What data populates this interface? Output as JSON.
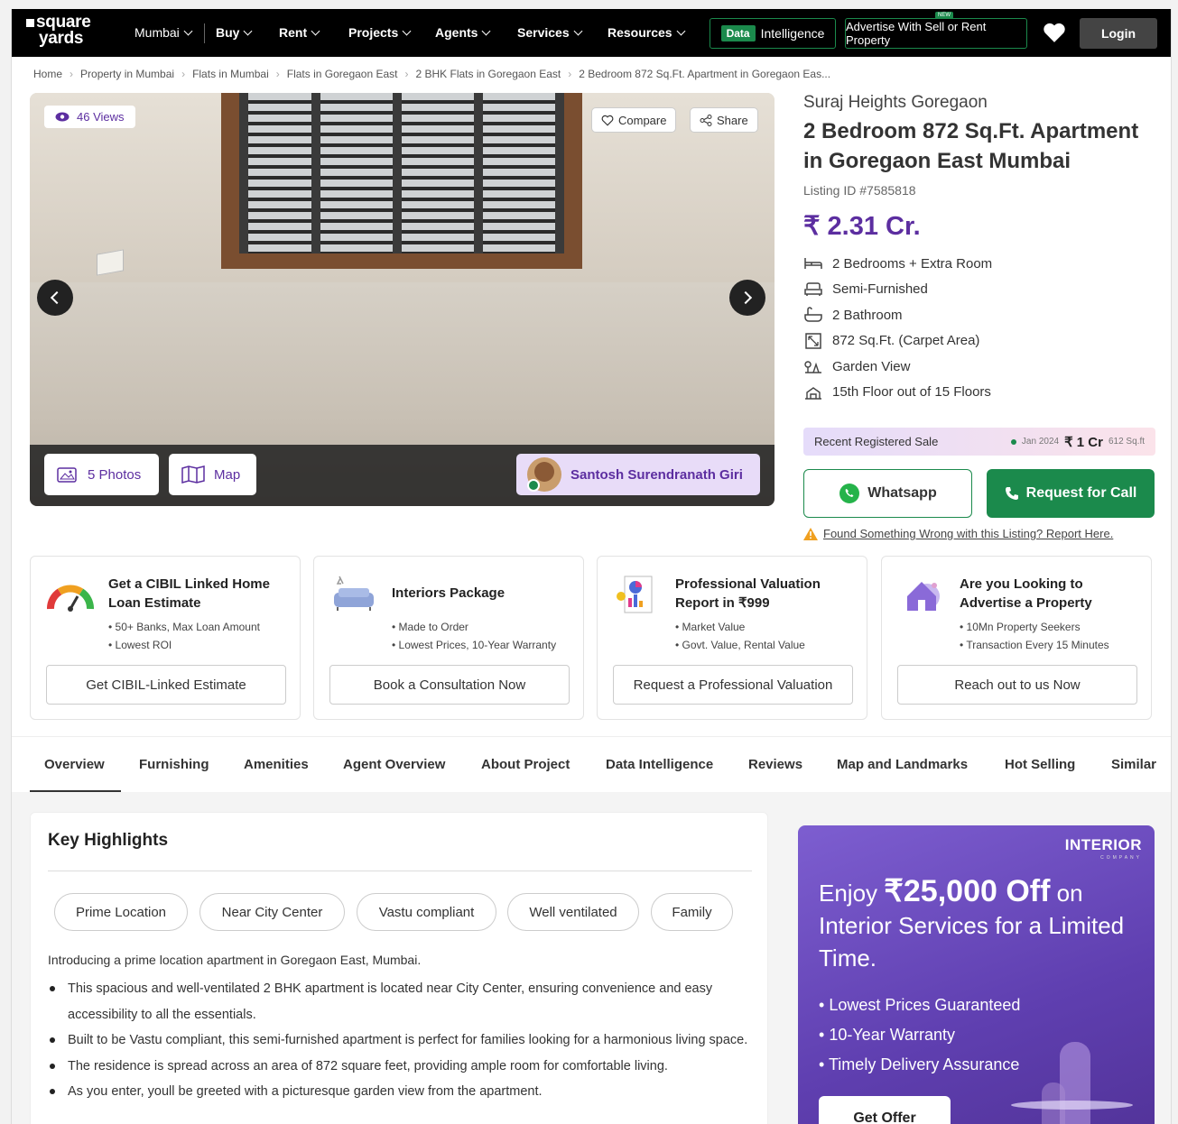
{
  "nav": {
    "logo_line1": "square",
    "logo_line2": "yards",
    "city": "Mumbai",
    "items": [
      "Buy",
      "Rent",
      "Projects",
      "Agents",
      "Services",
      "Resources"
    ],
    "data_tag": "Data",
    "data_label": "Intelligence",
    "advertise": "Advertise With Sell or Rent Property",
    "new_tag": "NEW",
    "login": "Login"
  },
  "breadcrumb": [
    "Home",
    "Property in Mumbai",
    "Flats in Mumbai",
    "Flats in Goregaon East",
    "2 BHK Flats in Goregaon East",
    "2 Bedroom 872 Sq.Ft. Apartment in Goregaon Eas..."
  ],
  "gallery": {
    "views": "46 Views",
    "compare": "Compare",
    "share": "Share",
    "photos": "5 Photos",
    "map": "Map",
    "agent": "Santosh Surendranath Giri"
  },
  "listing": {
    "project": "Suraj Heights Goregaon",
    "title": "2 Bedroom 872 Sq.Ft. Apartment in Goregaon East Mumbai",
    "listing_id": "Listing ID #7585818",
    "price": "₹ 2.31 Cr.",
    "features": [
      {
        "icon": "bed-icon",
        "text": "2 Bedrooms + Extra Room"
      },
      {
        "icon": "sofa-icon",
        "text": "Semi-Furnished"
      },
      {
        "icon": "bathtub-icon",
        "text": "2 Bathroom"
      },
      {
        "icon": "area-icon",
        "text": "872 Sq.Ft. (Carpet Area)"
      },
      {
        "icon": "garden-icon",
        "text": "Garden View"
      },
      {
        "icon": "floor-icon",
        "text": "15th Floor out of 15 Floors"
      }
    ],
    "reg_sale_label": "Recent Registered Sale",
    "reg_sale_date": "Jan 2024",
    "reg_sale_amount": "₹ 1 Cr",
    "reg_sale_area": "612 Sq.ft",
    "whatsapp": "Whatsapp",
    "request_call": "Request for Call",
    "report": "Found Something Wrong with this Listing? Report Here."
  },
  "cards": [
    {
      "title": "Get a CIBIL Linked Home Loan Estimate",
      "points": [
        "50+ Banks, Max Loan Amount",
        "Lowest ROI"
      ],
      "button": "Get CIBIL-Linked Estimate",
      "icon": "gauge-icon"
    },
    {
      "title": "Interiors Package",
      "points": [
        "Made to Order",
        "Lowest Prices, 10-Year Warranty"
      ],
      "button": "Book a Consultation Now",
      "icon": "sofa-lamp-icon"
    },
    {
      "title": "Professional Valuation Report in ₹999",
      "points": [
        "Market Value",
        "Govt. Value, Rental Value"
      ],
      "button": "Request a Professional Valuation",
      "icon": "report-icon"
    },
    {
      "title": "Are you Looking to Advertise a Property",
      "points": [
        "10Mn Property Seekers",
        "Transaction Every 15 Minutes"
      ],
      "button": "Reach out to us Now",
      "icon": "house-icon"
    }
  ],
  "tabs": [
    "Overview",
    "Furnishing",
    "Amenities",
    "Agent Overview",
    "About Project",
    "Data Intelligence",
    "Reviews",
    "Map and Landmarks",
    "Hot Selling",
    "Similar"
  ],
  "highlights": {
    "heading": "Key Highlights",
    "chips": [
      "Prime Location",
      "Near City Center",
      "Vastu compliant",
      "Well ventilated",
      "Family"
    ],
    "intro": "Introducing a prime location apartment in Goregaon East, Mumbai.",
    "bullets": [
      "This spacious and well-ventilated 2 BHK apartment is located near City Center, ensuring convenience and easy accessibility to all the essentials.",
      "Built to be Vastu compliant, this semi-furnished apartment is perfect for families looking for a harmonious living space.",
      "The residence is spread across an area of 872 square feet, providing ample room for comfortable living.",
      "As you enter, youll be greeted with a picturesque garden view from the apartment."
    ]
  },
  "promo": {
    "brand": "INTERIOR",
    "brand_sub": "COMPANY",
    "line_pre": "Enjoy ",
    "amount": "₹25,000 Off",
    "line_post": " on Interior Services for a Limited Time.",
    "points": [
      "Lowest Prices Guaranteed",
      "10-Year Warranty",
      "Timely Delivery Assurance"
    ],
    "cta": "Get Offer"
  },
  "colors": {
    "brand_purple": "#5c2ea0",
    "green": "#1b8a4c",
    "nav_bg": "#000000"
  }
}
